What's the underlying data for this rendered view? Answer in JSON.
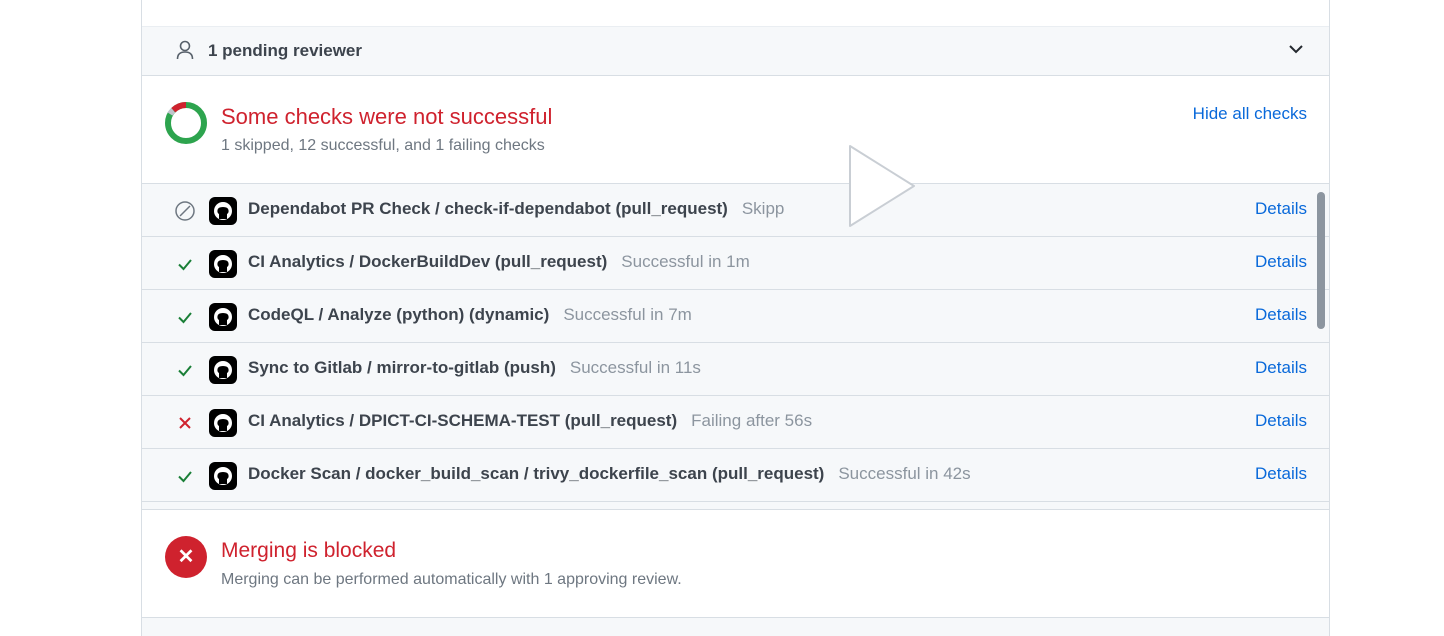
{
  "reviewers": {
    "label": "1 pending reviewer"
  },
  "checks": {
    "title": "Some checks were not successful",
    "summary": "1 skipped, 12 successful, and 1 failing checks",
    "hide_label": "Hide all checks",
    "items": [
      {
        "status": "skipped",
        "name": "Dependabot PR Check / check-if-dependabot (pull_request)",
        "duration": "Skipp",
        "details": "Details"
      },
      {
        "status": "success",
        "name": "CI Analytics / DockerBuildDev (pull_request)",
        "duration": "Successful in 1m",
        "details": "Details"
      },
      {
        "status": "success",
        "name": "CodeQL / Analyze (python) (dynamic)",
        "duration": "Successful in 7m",
        "details": "Details"
      },
      {
        "status": "success",
        "name": "Sync to Gitlab / mirror-to-gitlab (push)",
        "duration": "Successful in 11s",
        "details": "Details"
      },
      {
        "status": "failure",
        "name": "CI Analytics / DPICT-CI-SCHEMA-TEST (pull_request)",
        "duration": "Failing after 56s",
        "details": "Details"
      },
      {
        "status": "success",
        "name": "Docker Scan / docker_build_scan / trivy_dockerfile_scan (pull_request)",
        "duration": "Successful in 42s",
        "details": "Details"
      }
    ]
  },
  "merge": {
    "title": "Merging is blocked",
    "subtitle": "Merging can be performed automatically with 1 approving review."
  },
  "icons": {
    "reviewer": "person-icon",
    "expand": "chevron-down-icon",
    "checks_status": "status-ring-icon",
    "skipped": "skip-icon",
    "success": "check-icon",
    "failure": "x-icon",
    "provider": "github-icon",
    "merge_blocked": "x-circle-icon",
    "video": "play-icon"
  },
  "colors": {
    "danger": "#cf222e",
    "success": "#1a7f37",
    "link": "#0969da",
    "muted": "#6e7781"
  }
}
